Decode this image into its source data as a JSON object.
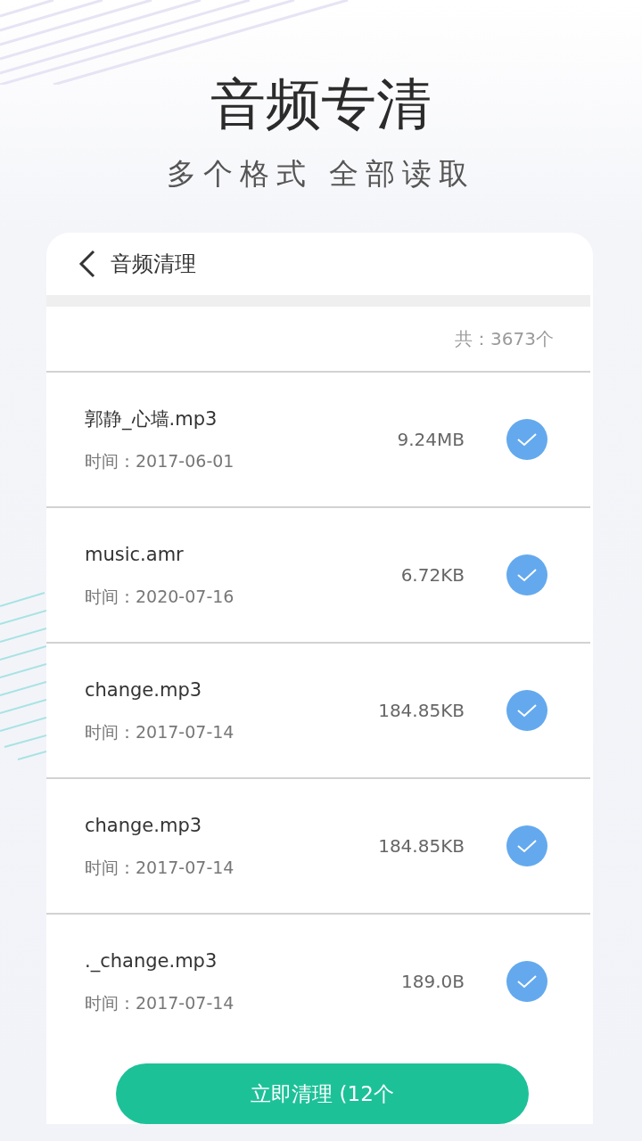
{
  "headline": {
    "title": "音频专清",
    "subtitle": "多个格式 全部读取"
  },
  "screen": {
    "title": "音频清理",
    "total": "共：3673个",
    "files": [
      {
        "name": "郭静_心墙.mp3",
        "time": "时间：2017-06-01",
        "size": "9.24MB",
        "checked": true
      },
      {
        "name": "music.amr",
        "time": "时间：2020-07-16",
        "size": "6.72KB",
        "checked": true
      },
      {
        "name": "change.mp3",
        "time": "时间：2017-07-14",
        "size": "184.85KB",
        "checked": true
      },
      {
        "name": "change.mp3",
        "time": "时间：2017-07-14",
        "size": "184.85KB",
        "checked": true
      },
      {
        "name": "._change.mp3",
        "time": "时间：2017-07-14",
        "size": "189.0B",
        "checked": true
      }
    ],
    "button": "立即清理 (12个"
  }
}
